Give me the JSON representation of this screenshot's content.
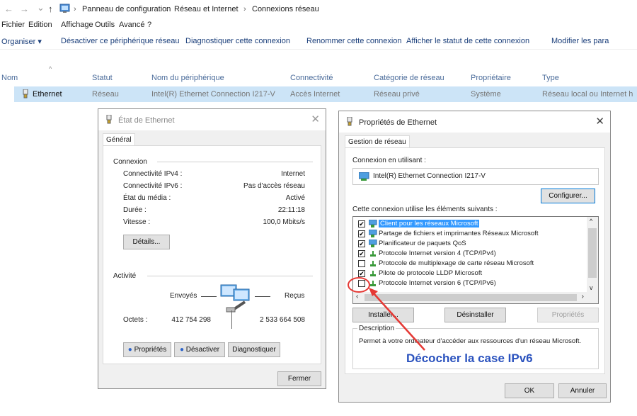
{
  "address": {
    "back": "←",
    "forward": "→",
    "recent": "⌄",
    "up": "↑",
    "crumbs": [
      "Panneau de configuration",
      "Réseau et Internet",
      "Connexions réseau"
    ],
    "separator": "›"
  },
  "menu": [
    "Fichier",
    "Edition",
    "Affichage",
    "Outils",
    "Avancé",
    "?"
  ],
  "commands": [
    "Organiser ▾",
    "Désactiver ce périphérique réseau",
    "Diagnostiquer cette connexion",
    "Renommer cette connexion",
    "Afficher le statut de cette connexion",
    "Modifier les para"
  ],
  "columns": [
    "Nom",
    "Statut",
    "Nom du périphérique",
    "Connectivité",
    "Catégorie de réseau",
    "Propriétaire",
    "Type"
  ],
  "row": [
    "Ethernet",
    "Réseau",
    "Intel(R) Ethernet Connection I217-V",
    "Accès Internet",
    "Réseau privé",
    "Système",
    "Réseau local ou Internet h"
  ],
  "status_dialog": {
    "title": "État de Ethernet",
    "tab": "Général",
    "connexion_group": "Connexion",
    "fields": [
      {
        "label": "Connectivité IPv4 :",
        "value": "Internet"
      },
      {
        "label": "Connectivité IPv6 :",
        "value": "Pas d'accès réseau"
      },
      {
        "label": "État du média :",
        "value": "Activé"
      },
      {
        "label": "Durée :",
        "value": "22:11:18"
      },
      {
        "label": "Vitesse :",
        "value": "100,0 Mbits/s"
      }
    ],
    "details_button": "Détails...",
    "activity_group": "Activité",
    "sent_label": "Envoyés",
    "received_label": "Reçus",
    "octets_label": "Octets :",
    "sent_value": "412 754 298",
    "received_value": "2 533 664 508",
    "properties_button": "Propriétés",
    "disable_button": "Désactiver",
    "diagnose_button": "Diagnostiquer",
    "close_button": "Fermer"
  },
  "props_dialog": {
    "title": "Propriétés de Ethernet",
    "tab": "Gestion de réseau",
    "connect_using_label": "Connexion en utilisant :",
    "adapter": "Intel(R) Ethernet Connection I217-V",
    "configure_button": "Configurer...",
    "items_label": "Cette connexion utilise les éléments suivants :",
    "items": [
      {
        "checked": true,
        "label": "Client pour les réseaux Microsoft",
        "selected": true,
        "icon": "network-client-icon"
      },
      {
        "checked": true,
        "label": "Partage de fichiers et imprimantes Réseaux Microsoft",
        "selected": false,
        "icon": "network-client-icon"
      },
      {
        "checked": true,
        "label": "Planificateur de paquets QoS",
        "selected": false,
        "icon": "network-client-icon"
      },
      {
        "checked": true,
        "label": "Protocole Internet version 4 (TCP/IPv4)",
        "selected": false,
        "icon": "protocol-icon"
      },
      {
        "checked": false,
        "label": "Protocole de multiplexage de carte réseau Microsoft",
        "selected": false,
        "icon": "protocol-icon"
      },
      {
        "checked": true,
        "label": "Pilote de protocole LLDP Microsoft",
        "selected": false,
        "icon": "protocol-icon"
      },
      {
        "checked": false,
        "label": "Protocole Internet version 6 (TCP/IPv6)",
        "selected": false,
        "icon": "protocol-icon"
      }
    ],
    "install_button": "Installer...",
    "uninstall_button": "Désinstaller",
    "properties_button": "Propriétés",
    "description_group": "Description",
    "description_text": "Permet à votre ordinateur d'accéder aux ressources d'un réseau Microsoft.",
    "ok_button": "OK",
    "cancel_button": "Annuler"
  },
  "annotation": "Décocher la case IPv6",
  "colors": {
    "selection": "#cce4f7",
    "list_selection": "#3399ff",
    "annotation": "#2a52be",
    "arrow": "#e53935"
  }
}
